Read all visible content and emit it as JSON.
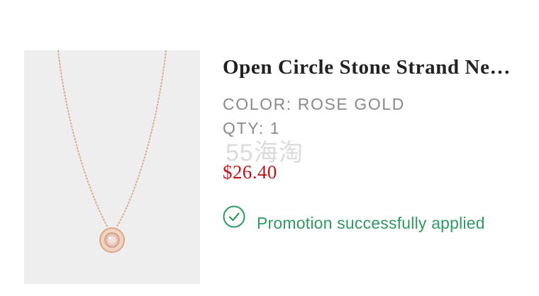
{
  "product": {
    "title": "Open Circle Stone Strand Ne…",
    "color_line": "COLOR: ROSE GOLD",
    "qty_line": "QTY: 1",
    "price": "$26.40",
    "image_icon": "necklace-image"
  },
  "watermark": {
    "text": "55海淘"
  },
  "promotion": {
    "icon": "check-circle-icon",
    "message": "Promotion successfully applied"
  },
  "colors": {
    "price": "#c0141a",
    "promo": "#2f9a62",
    "meta": "#8a8a8a",
    "image_bg": "#eeeeee",
    "chain": "#d9b08c"
  }
}
